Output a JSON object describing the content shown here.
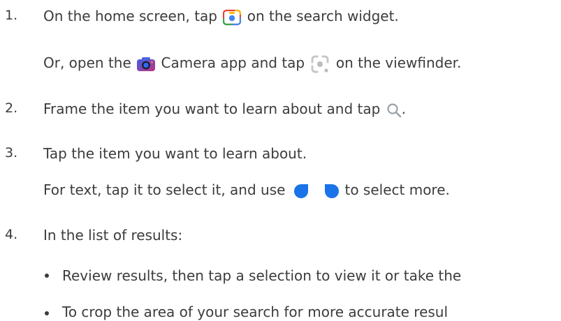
{
  "steps": [
    {
      "number": "1.",
      "text_before": "On the home screen, tap",
      "icon": "google-lens-icon",
      "text_after": "on the search widget.",
      "sub": {
        "text_a": "Or, open the",
        "icon_a": "camera-app-icon",
        "text_b": "Camera app and tap",
        "icon_b": "lens-viewfinder-icon",
        "text_c": "on the viewfinder."
      }
    },
    {
      "number": "2.",
      "text_before": "Frame the item you want to learn about and tap",
      "icon": "search-icon",
      "text_after": "."
    },
    {
      "number": "3.",
      "text": "Tap the item you want to learn about.",
      "sub": {
        "text_a": "For text, tap it to select it, and use",
        "icon_a": "selection-handle-left-icon",
        "icon_b": "selection-handle-right-icon",
        "text_b": "to select more."
      }
    },
    {
      "number": "4.",
      "text": "In the list of results:",
      "bullets": [
        "Review results, then tap a selection to view it or take the",
        "To crop the area of your search for more accurate resul"
      ]
    }
  ],
  "colors": {
    "text": "#3c3c3c",
    "handle_blue": "#1a73e8",
    "lens_blue": "#4285f4",
    "search_gray": "#9aa0a6"
  }
}
